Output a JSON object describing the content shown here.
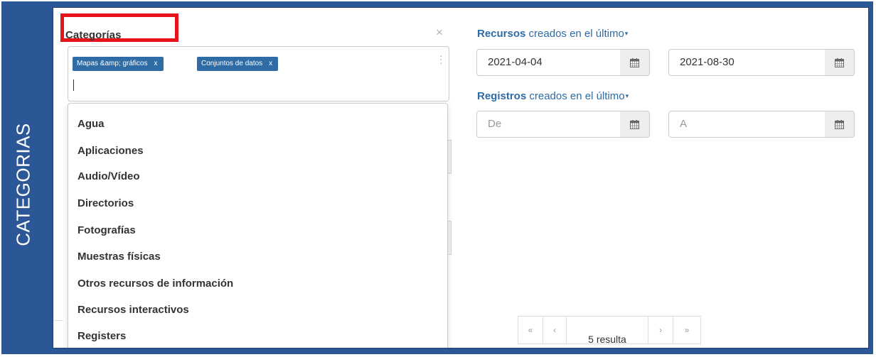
{
  "side_tab": {
    "label": "CATEGORIAS"
  },
  "categories": {
    "title": "Categorías",
    "close_icon": "×",
    "tags": [
      {
        "label": "Mapas &amp; gráficos",
        "remove": "x"
      },
      {
        "label": "Conjuntos de datos",
        "remove": "x"
      }
    ],
    "menu_icon": "⋮",
    "options": [
      "Agua",
      "Aplicaciones",
      "Audio/Vídeo",
      "Directorios",
      "Fotografías",
      "Muestras físicas",
      "Otros recursos de información",
      "Recursos interactivos",
      "Registers"
    ]
  },
  "resources_filter": {
    "label_strong": "Recursos",
    "label_rest": " creados en el último",
    "caret": "▾",
    "from_value": "2021-04-04",
    "to_value": "2021-08-30"
  },
  "records_filter": {
    "label_strong": "Registros",
    "label_rest": " creados en el último",
    "caret": "▾",
    "from_placeholder": "De",
    "to_placeholder": "A"
  },
  "pagination": {
    "first": "«",
    "prev": "‹",
    "info": "5 resulta",
    "next": "›",
    "last": "»"
  },
  "colors": {
    "frame": "#2b5797",
    "tag": "#2f6ca6",
    "highlight": "#e8141c",
    "link": "#2f6ca6"
  }
}
